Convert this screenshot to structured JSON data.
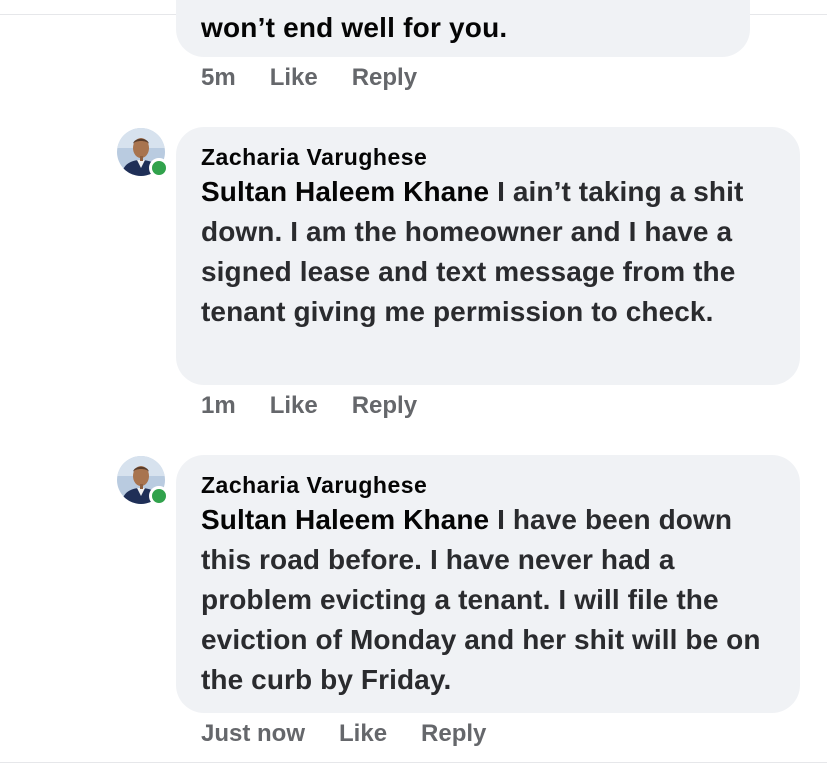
{
  "previous_comment": {
    "text": "won’t end well for you.",
    "time": "5m",
    "like_label": "Like",
    "reply_label": "Reply"
  },
  "comments": [
    {
      "author": "Zacharia Varughese",
      "mention": "Sultan Haleem Khane",
      "text": " I ain’t taking a shit down. I am the homeowner and I have a signed lease and text message from the tenant giving me permission to check.",
      "time": "1m",
      "like_label": "Like",
      "reply_label": "Reply"
    },
    {
      "author": "Zacharia Varughese",
      "mention": "Sultan Haleem Khane",
      "text": " I have been down this road before. I have never had a problem evicting a tenant. I will file the eviction of Monday and her shit will be on the curb by Friday.",
      "time": "Just now",
      "like_label": "Like",
      "reply_label": "Reply"
    }
  ],
  "colors": {
    "bubble_bg": "#f0f2f5",
    "meta_text": "#65676b",
    "online_green": "#31a24c"
  },
  "icons": {
    "avatar": "profile-photo",
    "online": "online-status-dot"
  }
}
